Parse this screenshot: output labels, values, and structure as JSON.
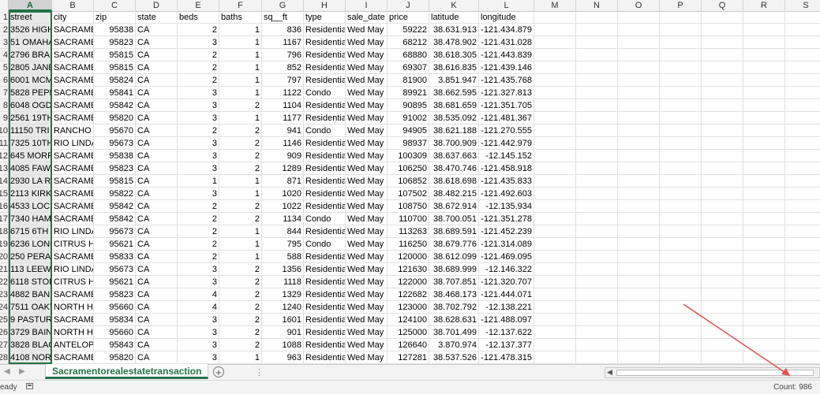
{
  "columns": [
    "A",
    "B",
    "C",
    "D",
    "E",
    "F",
    "G",
    "H",
    "I",
    "J",
    "K",
    "L",
    "M",
    "N",
    "O",
    "P",
    "Q",
    "R",
    "S"
  ],
  "row_numbers": [
    "1",
    "2",
    "3",
    "4",
    "5",
    "6",
    "7",
    "8",
    "9",
    "10",
    "11",
    "12",
    "13",
    "14",
    "15",
    "16",
    "17",
    "18",
    "19",
    "20",
    "21",
    "22",
    "23",
    "24",
    "25",
    "26",
    "27",
    "28"
  ],
  "rows": [
    [
      "street",
      "city",
      "zip",
      "state",
      "beds",
      "baths",
      "sq__ft",
      "type",
      "sale_date",
      "price",
      "latitude",
      "longitude"
    ],
    [
      "3526 HIGH",
      "SACRAMEN",
      "95838",
      "CA",
      "2",
      "1",
      "836",
      "Residentia",
      "Wed May",
      "59222",
      "38.631.913",
      "-121.434.879"
    ],
    [
      "51 OMAHA",
      "SACRAMEN",
      "95823",
      "CA",
      "3",
      "1",
      "1167",
      "Residentia",
      "Wed May",
      "68212",
      "38.478.902",
      "-121.431.028"
    ],
    [
      "2796 BRAN",
      "SACRAMEN",
      "95815",
      "CA",
      "2",
      "1",
      "796",
      "Residentia",
      "Wed May",
      "68880",
      "38.618.305",
      "-121.443.839"
    ],
    [
      "2805 JANE",
      "SACRAMEN",
      "95815",
      "CA",
      "2",
      "1",
      "852",
      "Residentia",
      "Wed May",
      "69307",
      "38.616.835",
      "-121.439.146"
    ],
    [
      "6001 MCM",
      "SACRAMEN",
      "95824",
      "CA",
      "2",
      "1",
      "797",
      "Residentia",
      "Wed May",
      "81900",
      "3.851.947",
      "-121.435.768"
    ],
    [
      "5828 PEPP",
      "SACRAMEN",
      "95841",
      "CA",
      "3",
      "1",
      "1122",
      "Condo",
      "Wed May",
      "89921",
      "38.662.595",
      "-121.327.813"
    ],
    [
      "6048 OGD",
      "SACRAMEN",
      "95842",
      "CA",
      "3",
      "2",
      "1104",
      "Residentia",
      "Wed May",
      "90895",
      "38.681.659",
      "-121.351.705"
    ],
    [
      "2561 19TH",
      "SACRAMEN",
      "95820",
      "CA",
      "3",
      "1",
      "1177",
      "Residentia",
      "Wed May",
      "91002",
      "38.535.092",
      "-121.481.367"
    ],
    [
      "11150 TRI",
      "RANCHO C",
      "95670",
      "CA",
      "2",
      "2",
      "941",
      "Condo",
      "Wed May",
      "94905",
      "38.621.188",
      "-121.270.555"
    ],
    [
      "7325 10TH",
      "RIO LINDA",
      "95673",
      "CA",
      "3",
      "2",
      "1146",
      "Residentia",
      "Wed May",
      "98937",
      "38.700.909",
      "-121.442.979"
    ],
    [
      "645 MORR",
      "SACRAMEN",
      "95838",
      "CA",
      "3",
      "2",
      "909",
      "Residentia",
      "Wed May",
      "100309",
      "38.637.663",
      "-12.145.152"
    ],
    [
      "4085 FAW",
      "SACRAMEN",
      "95823",
      "CA",
      "3",
      "2",
      "1289",
      "Residentia",
      "Wed May",
      "106250",
      "38.470.746",
      "-121.458.918"
    ],
    [
      "2930 LA R",
      "SACRAMEN",
      "95815",
      "CA",
      "1",
      "1",
      "871",
      "Residentia",
      "Wed May",
      "106852",
      "38.618.698",
      "-121.435.833"
    ],
    [
      "2113 KIRK",
      "SACRAMEN",
      "95822",
      "CA",
      "3",
      "1",
      "1020",
      "Residentia",
      "Wed May",
      "107502",
      "38.482.215",
      "-121.492.603"
    ],
    [
      "4533 LOCH",
      "SACRAMEN",
      "95842",
      "CA",
      "2",
      "2",
      "1022",
      "Residentia",
      "Wed May",
      "108750",
      "38.672.914",
      "-12.135.934"
    ],
    [
      "7340 HAM",
      "SACRAMEN",
      "95842",
      "CA",
      "2",
      "2",
      "1134",
      "Condo",
      "Wed May",
      "110700",
      "38.700.051",
      "-121.351.278"
    ],
    [
      "6715 6TH",
      "RIO LINDA",
      "95673",
      "CA",
      "2",
      "1",
      "844",
      "Residentia",
      "Wed May",
      "113263",
      "38.689.591",
      "-121.452.239"
    ],
    [
      "6236 LONG",
      "CITRUS HE",
      "95621",
      "CA",
      "2",
      "1",
      "795",
      "Condo",
      "Wed May",
      "116250",
      "38.679.776",
      "-121.314.089"
    ],
    [
      "250 PERAL",
      "SACRAMEN",
      "95833",
      "CA",
      "2",
      "1",
      "588",
      "Residentia",
      "Wed May",
      "120000",
      "38.612.099",
      "-121.469.095"
    ],
    [
      "113 LEEW",
      "RIO LINDA",
      "95673",
      "CA",
      "3",
      "2",
      "1356",
      "Residentia",
      "Wed May",
      "121630",
      "38.689.999",
      "-12.146.322"
    ],
    [
      "6118 STON",
      "CITRUS HE",
      "95621",
      "CA",
      "3",
      "2",
      "1118",
      "Residentia",
      "Wed May",
      "122000",
      "38.707.851",
      "-121.320.707"
    ],
    [
      "4882 BANI",
      "SACRAMEN",
      "95823",
      "CA",
      "4",
      "2",
      "1329",
      "Residentia",
      "Wed May",
      "122682",
      "38.468.173",
      "-121.444.071"
    ],
    [
      "7511 OAKV",
      "NORTH HI",
      "95660",
      "CA",
      "4",
      "2",
      "1240",
      "Residentia",
      "Wed May",
      "123000",
      "38.702.792",
      "-12.138.221"
    ],
    [
      "9 PASTURI",
      "SACRAMEN",
      "95834",
      "CA",
      "3",
      "2",
      "1601",
      "Residentia",
      "Wed May",
      "124100",
      "38.628.631",
      "-121.488.097"
    ],
    [
      "3729 BAIN",
      "NORTH HI",
      "95660",
      "CA",
      "3",
      "2",
      "901",
      "Residentia",
      "Wed May",
      "125000",
      "38.701.499",
      "-12.137.622"
    ],
    [
      "3828 BLAC",
      "ANTELOPE",
      "95843",
      "CA",
      "3",
      "2",
      "1088",
      "Residentia",
      "Wed May",
      "126640",
      "3.870.974",
      "-12.137.377"
    ],
    [
      "4108 NOR",
      "SACRAMEN",
      "95820",
      "CA",
      "3",
      "1",
      "963",
      "Residentia",
      "Wed May",
      "127281",
      "38.537.526",
      "-121.478.315"
    ]
  ],
  "sheet_tab": "Sacramentorealestatetransaction",
  "add_sheet_label": "+",
  "nav_prev": "◀",
  "nav_next": "▶",
  "tab_more": "⋮",
  "scroll_left": "◀",
  "status": {
    "ready": "eady",
    "count": "Count: 986"
  },
  "annotation_color": "#e05050"
}
